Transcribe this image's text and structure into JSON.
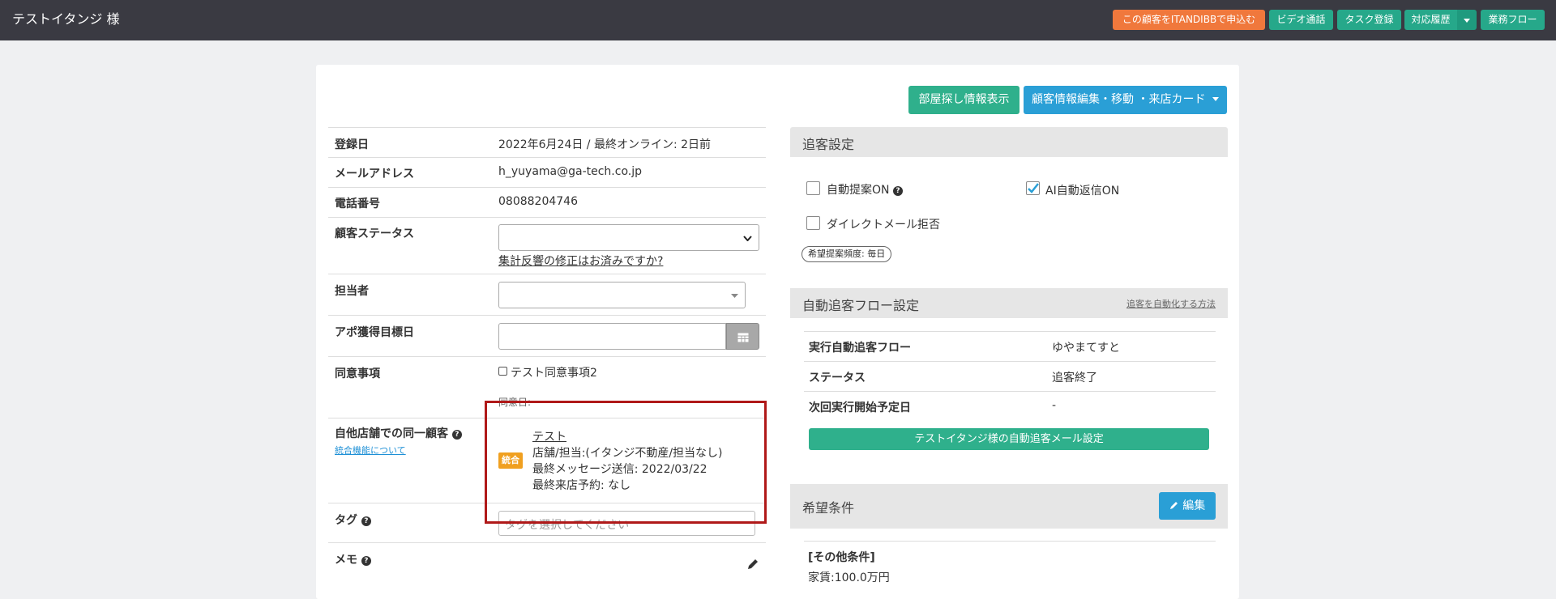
{
  "header": {
    "customer_name": "テストイタンジ 様",
    "buttons": {
      "itandi": "この顧客をITANDIBBで申込む",
      "video": "ビデオ通話",
      "task": "タスク登録",
      "history": "対応履歴",
      "workflow": "業務フロー"
    }
  },
  "actions": {
    "room_search": "部屋探し情報表示",
    "edit_customer": "顧客情報編集・移動 ・来店カード"
  },
  "customer": {
    "registered": {
      "label": "登録日",
      "value": "2022年6月24日 / 最終オンライン: 2日前"
    },
    "email": {
      "label": "メールアドレス",
      "value": "h_yuyama@ga-tech.co.jp"
    },
    "phone": {
      "label": "電話番号",
      "value": "08088204746"
    },
    "status": {
      "label": "顧客ステータス",
      "link": "集計反響の修正はお済みですか?"
    },
    "staff": {
      "label": "担当者"
    },
    "appointment_target": {
      "label": "アポ獲得目標日"
    },
    "consent": {
      "label": "同意事項",
      "item": "テスト同意事項2",
      "date_label": "同意日:"
    },
    "same_customer": {
      "label": "自他店舗での同一顧客",
      "help_link": "統合機能について",
      "badge": "統合",
      "name": "テスト",
      "shop": "店舗/担当:(イタンジ不動産/担当なし)",
      "last_message": "最終メッセージ送信: 2022/03/22",
      "last_visit": "最終来店予約: なし"
    },
    "tags": {
      "label": "タグ",
      "placeholder": "タグを選択してください"
    },
    "memo": {
      "label": "メモ"
    }
  },
  "follow_settings": {
    "title": "追客設定",
    "auto_suggest": "自動提案ON",
    "ai_reply": "AI自動返信ON",
    "dm_reject": "ダイレクトメール拒否",
    "frequency": "希望提案頻度: 毎日"
  },
  "auto_flow": {
    "title": "自動追客フロー設定",
    "howto_link": "追客を自動化する方法",
    "rows": [
      {
        "label": "実行自動追客フロー",
        "value": "ゆやまてすと"
      },
      {
        "label": "ステータス",
        "value": "追客終了"
      },
      {
        "label": "次回実行開始予定日",
        "value": "-"
      }
    ],
    "mail_button": "テストイタンジ様の自動追客メール設定"
  },
  "conditions": {
    "title": "希望条件",
    "edit_button": "編集",
    "section": "[その他条件]",
    "rent": "家賃:100.0万円"
  },
  "colors": {
    "topbar": "#3a3a42",
    "orange": "#f0783c",
    "teal": "#2fb08c",
    "blue": "#2a9fd6",
    "badge": "#f0a020",
    "highlight": "#b01919"
  }
}
